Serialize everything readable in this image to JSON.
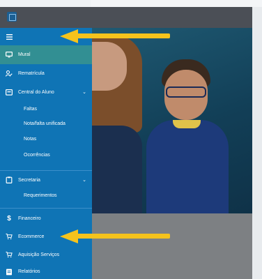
{
  "colors": {
    "sidebar": "#0f74b5",
    "active_item": "#328f93",
    "header": "#4b4f56",
    "arrow": "#f5c31c"
  },
  "sidebar": {
    "menu_icon": "hamburger-icon",
    "items": [
      {
        "label": "Mural",
        "icon": "monitor-icon",
        "active": true
      },
      {
        "label": "Rematrícula",
        "icon": "user-edit-icon"
      },
      {
        "label": "Central do Aluno",
        "icon": "graduation-cap-icon",
        "expanded": true,
        "children": [
          "Faltas",
          "Nota/falta unificada",
          "Notas",
          "Ocorrências"
        ]
      },
      {
        "label": "Secretaria",
        "icon": "clipboard-icon",
        "expanded": true,
        "children": [
          "Requerimentos"
        ]
      },
      {
        "label": "Financeiro",
        "icon": "dollar-icon"
      },
      {
        "label": "Ecommerce",
        "icon": "cart-icon"
      },
      {
        "label": "Aquisição Serviços",
        "icon": "cart-icon"
      },
      {
        "label": "Relatórios",
        "icon": "report-icon"
      }
    ],
    "chevron": "⌄"
  }
}
